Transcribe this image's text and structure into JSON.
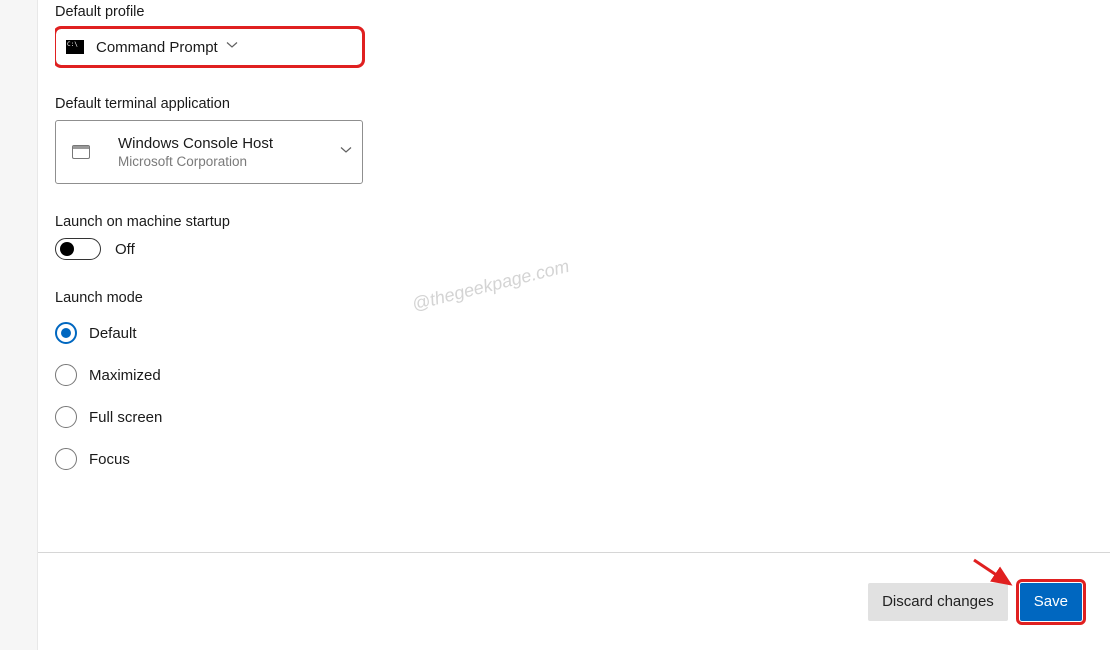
{
  "defaultProfile": {
    "label": "Default profile",
    "selected": "Command Prompt"
  },
  "defaultTerminal": {
    "label": "Default terminal application",
    "primary": "Windows Console Host",
    "secondary": "Microsoft Corporation"
  },
  "launchOnStartup": {
    "label": "Launch on machine startup",
    "state": "Off"
  },
  "launchMode": {
    "label": "Launch mode",
    "options": [
      "Default",
      "Maximized",
      "Full screen",
      "Focus"
    ],
    "selected": "Default"
  },
  "footer": {
    "discard": "Discard changes",
    "save": "Save"
  },
  "watermark": "@thegeekpage.com"
}
